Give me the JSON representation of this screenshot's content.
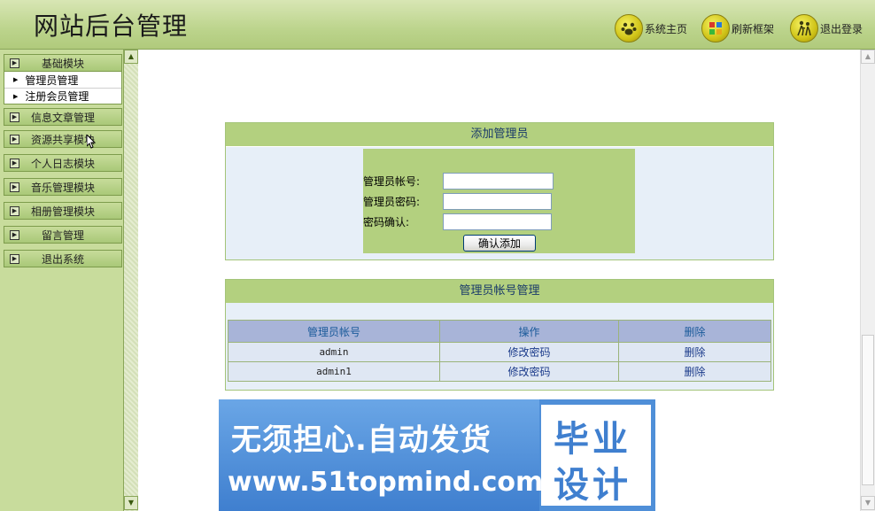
{
  "header": {
    "title": "网站后台管理",
    "buttons": [
      {
        "label": "系统主页",
        "icon": "paw-icon"
      },
      {
        "label": "刷新框架",
        "icon": "refresh-icon"
      },
      {
        "label": "退出登录",
        "icon": "logout-icon"
      }
    ]
  },
  "sidebar": {
    "categories": [
      {
        "label": "基础模块",
        "expanded": true,
        "items": [
          "管理员管理",
          "注册会员管理"
        ]
      },
      {
        "label": "信息文章管理"
      },
      {
        "label": "资源共享模块"
      },
      {
        "label": "个人日志模块"
      },
      {
        "label": "音乐管理模块"
      },
      {
        "label": "相册管理模块"
      },
      {
        "label": "留言管理"
      },
      {
        "label": "退出系统"
      }
    ]
  },
  "add_form": {
    "title": "添加管理员",
    "account_label": "管理员帐号:",
    "password_label": "管理员密码:",
    "confirm_label": "密码确认:",
    "account_value": "",
    "password_value": "",
    "confirm_value": "",
    "submit_label": "确认添加"
  },
  "account_list": {
    "title": "管理员帐号管理",
    "columns": [
      "管理员帐号",
      "操作",
      "删除"
    ],
    "rows": [
      {
        "account": "admin",
        "action": "修改密码",
        "delete": "删除"
      },
      {
        "account": "admin1",
        "action": "修改密码",
        "delete": "删除"
      }
    ]
  },
  "banner": {
    "line1": "无须担心.自动发货",
    "line2": "www.51topmind.com",
    "right1": "毕业",
    "right2": "设计"
  },
  "colors": {
    "header_green": "#b0ca7c",
    "panel_title_green": "#b3d07f",
    "table_header_blue": "#a8b4d8",
    "banner_blue": "#4f8fd8"
  }
}
